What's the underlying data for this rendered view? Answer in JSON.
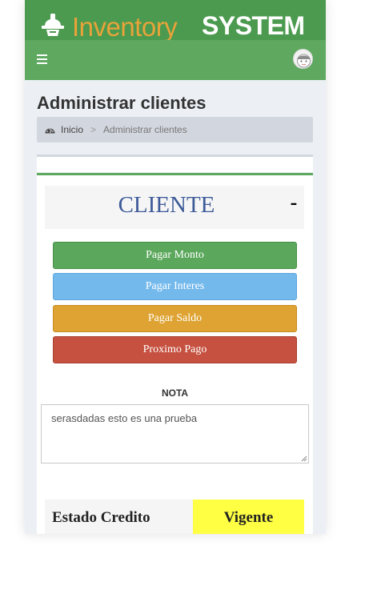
{
  "header": {
    "logo_text_1": "Inventory",
    "logo_text_2": "SYSTEM",
    "logo_icon": "hard-hat-icon",
    "menu_icon": "hamburger-menu-icon",
    "user_icon": "user-avatar-icon"
  },
  "page": {
    "title": "Administrar clientes"
  },
  "breadcrumb": {
    "icon": "dashboard-icon",
    "home": "Inicio",
    "separator": ">",
    "current": "Administrar clientes"
  },
  "client_box": {
    "title": "CLIENTE",
    "collapse_label": "-",
    "buttons": {
      "pay_amount": "Pagar Monto",
      "pay_interest": "Pagar Interes",
      "pay_balance": "Pagar Saldo",
      "next_payment": "Proximo Pago"
    },
    "note_label": "NOTA",
    "note_value": "serasdadas esto es una prueba",
    "status_label": "Estado Credito",
    "status_value": "Vigente"
  },
  "colors": {
    "header_dark": "#4b9a4f",
    "header_light": "#5ea860",
    "logo_orange": "#e8a33a",
    "btn_green": "#5ba85c",
    "btn_blue": "#74b9ec",
    "btn_orange": "#dea332",
    "btn_red": "#c65140",
    "status_yellow": "#ffff44",
    "title_blue": "#3d5a99"
  }
}
